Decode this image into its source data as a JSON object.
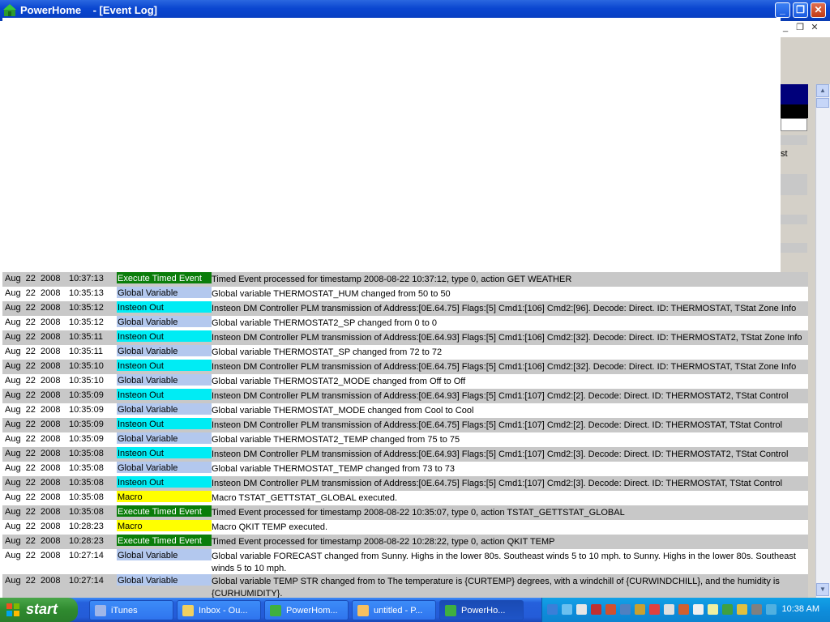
{
  "window": {
    "title": "PowerHome    - [Event Log]",
    "min_glyph": "_",
    "max_glyph": "❐",
    "close_glyph": "✕"
  },
  "mdi": {
    "min": "_",
    "restore": "❐",
    "close": "✕"
  },
  "right_panel": {
    "st_text": "st"
  },
  "rows": [
    {
      "date": "Aug  22  2008",
      "time": "10:37:13",
      "type": "Execute Timed Event",
      "type_color": "#0a7d0a",
      "type_text_color": "#ffffff",
      "msg": "Timed Event processed for timestamp 2008-08-22 10:37:12, type 0, action GET WEATHER",
      "bg": "gray"
    },
    {
      "date": "Aug  22  2008",
      "time": "10:35:13",
      "type": "Global Variable",
      "type_color": "#b3c8ee",
      "type_text_color": "#000000",
      "msg": "Global variable THERMOSTAT_HUM changed from 50 to 50",
      "bg": "white"
    },
    {
      "date": "Aug  22  2008",
      "time": "10:35:12",
      "type": "Insteon Out",
      "type_color": "#00ecf4",
      "type_text_color": "#000000",
      "msg": "Insteon DM Controller PLM transmission of Address:[0E.64.75] Flags:[5] Cmd1:[106] Cmd2:[96].  Decode: Direct. ID: THERMOSTAT, TStat Zone Info",
      "bg": "gray"
    },
    {
      "date": "Aug  22  2008",
      "time": "10:35:12",
      "type": "Global Variable",
      "type_color": "#b3c8ee",
      "type_text_color": "#000000",
      "msg": "Global variable THERMOSTAT2_SP changed from 0 to 0",
      "bg": "white"
    },
    {
      "date": "Aug  22  2008",
      "time": "10:35:11",
      "type": "Insteon Out",
      "type_color": "#00ecf4",
      "type_text_color": "#000000",
      "msg": "Insteon DM Controller PLM transmission of Address:[0E.64.93] Flags:[5] Cmd1:[106] Cmd2:[32].  Decode: Direct. ID: THERMOSTAT2, TStat Zone Info",
      "bg": "gray"
    },
    {
      "date": "Aug  22  2008",
      "time": "10:35:11",
      "type": "Global Variable",
      "type_color": "#b3c8ee",
      "type_text_color": "#000000",
      "msg": "Global variable THERMOSTAT_SP changed from 72 to 72",
      "bg": "white"
    },
    {
      "date": "Aug  22  2008",
      "time": "10:35:10",
      "type": "Insteon Out",
      "type_color": "#00ecf4",
      "type_text_color": "#000000",
      "msg": "Insteon DM Controller PLM transmission of Address:[0E.64.75] Flags:[5] Cmd1:[106] Cmd2:[32].  Decode: Direct. ID: THERMOSTAT, TStat Zone Info",
      "bg": "gray"
    },
    {
      "date": "Aug  22  2008",
      "time": "10:35:10",
      "type": "Global Variable",
      "type_color": "#b3c8ee",
      "type_text_color": "#000000",
      "msg": "Global variable THERMOSTAT2_MODE changed from Off to Off",
      "bg": "white"
    },
    {
      "date": "Aug  22  2008",
      "time": "10:35:09",
      "type": "Insteon Out",
      "type_color": "#00ecf4",
      "type_text_color": "#000000",
      "msg": "Insteon DM Controller PLM transmission of Address:[0E.64.93] Flags:[5] Cmd1:[107] Cmd2:[2].  Decode: Direct. ID: THERMOSTAT2, TStat Control",
      "bg": "gray"
    },
    {
      "date": "Aug  22  2008",
      "time": "10:35:09",
      "type": "Global Variable",
      "type_color": "#b3c8ee",
      "type_text_color": "#000000",
      "msg": "Global variable THERMOSTAT_MODE changed from Cool to Cool",
      "bg": "white"
    },
    {
      "date": "Aug  22  2008",
      "time": "10:35:09",
      "type": "Insteon Out",
      "type_color": "#00ecf4",
      "type_text_color": "#000000",
      "msg": "Insteon DM Controller PLM transmission of Address:[0E.64.75] Flags:[5] Cmd1:[107] Cmd2:[2].  Decode: Direct. ID: THERMOSTAT, TStat Control",
      "bg": "gray"
    },
    {
      "date": "Aug  22  2008",
      "time": "10:35:09",
      "type": "Global Variable",
      "type_color": "#b3c8ee",
      "type_text_color": "#000000",
      "msg": "Global variable THERMOSTAT2_TEMP changed from 75 to 75",
      "bg": "white"
    },
    {
      "date": "Aug  22  2008",
      "time": "10:35:08",
      "type": "Insteon Out",
      "type_color": "#00ecf4",
      "type_text_color": "#000000",
      "msg": "Insteon DM Controller PLM transmission of Address:[0E.64.93] Flags:[5] Cmd1:[107] Cmd2:[3].  Decode: Direct. ID: THERMOSTAT2, TStat Control",
      "bg": "gray"
    },
    {
      "date": "Aug  22  2008",
      "time": "10:35:08",
      "type": "Global Variable",
      "type_color": "#b3c8ee",
      "type_text_color": "#000000",
      "msg": "Global variable THERMOSTAT_TEMP changed from 73 to 73",
      "bg": "white"
    },
    {
      "date": "Aug  22  2008",
      "time": "10:35:08",
      "type": "Insteon Out",
      "type_color": "#00ecf4",
      "type_text_color": "#000000",
      "msg": "Insteon DM Controller PLM transmission of Address:[0E.64.75] Flags:[5] Cmd1:[107] Cmd2:[3].  Decode: Direct. ID: THERMOSTAT, TStat Control",
      "bg": "gray"
    },
    {
      "date": "Aug  22  2008",
      "time": "10:35:08",
      "type": "Macro",
      "type_color": "#ffff00",
      "type_text_color": "#000000",
      "msg": "Macro TSTAT_GETTSTAT_GLOBAL executed.",
      "bg": "white"
    },
    {
      "date": "Aug  22  2008",
      "time": "10:35:08",
      "type": "Execute Timed Event",
      "type_color": "#0a7d0a",
      "type_text_color": "#ffffff",
      "msg": "Timed Event processed for timestamp 2008-08-22 10:35:07, type 0, action TSTAT_GETTSTAT_GLOBAL",
      "bg": "gray"
    },
    {
      "date": "Aug  22  2008",
      "time": "10:28:23",
      "type": "Macro",
      "type_color": "#ffff00",
      "type_text_color": "#000000",
      "msg": "Macro QKIT TEMP executed.",
      "bg": "white"
    },
    {
      "date": "Aug  22  2008",
      "time": "10:28:23",
      "type": "Execute Timed Event",
      "type_color": "#0a7d0a",
      "type_text_color": "#ffffff",
      "msg": "Timed Event processed for timestamp 2008-08-22 10:28:22, type 0, action QKIT TEMP",
      "bg": "gray"
    },
    {
      "date": "Aug  22  2008",
      "time": "10:27:14",
      "type": "Global Variable",
      "type_color": "#b3c8ee",
      "type_text_color": "#000000",
      "msg": "Global variable FORECAST changed from Sunny. Highs in the lower 80s. Southeast winds 5 to 10 mph. to Sunny. Highs in the lower 80s. Southeast winds 5 to 10 mph.",
      "bg": "white",
      "tall": true
    },
    {
      "date": "Aug  22  2008",
      "time": "10:27:14",
      "type": "Global Variable",
      "type_color": "#b3c8ee",
      "type_text_color": "#000000",
      "msg": "Global variable TEMP STR changed from  to The temperature is {CURTEMP} degrees, with a windchill of {CURWINDCHILL},  and the humidity is {CURHUMIDITY}.",
      "bg": "gray",
      "tall": true
    }
  ],
  "taskbar": {
    "start": "start",
    "items": [
      {
        "label": "iTunes",
        "icon_color": "#9fb6e8"
      },
      {
        "label": "Inbox - Ou...",
        "icon_color": "#f0d060"
      },
      {
        "label": "PowerHom...",
        "icon_color": "#3fb03f"
      },
      {
        "label": "untitled - P...",
        "icon_color": "#f7c060"
      },
      {
        "label": "PowerHo...",
        "icon_color": "#3fb03f"
      }
    ],
    "clock": "10:38 AM"
  }
}
